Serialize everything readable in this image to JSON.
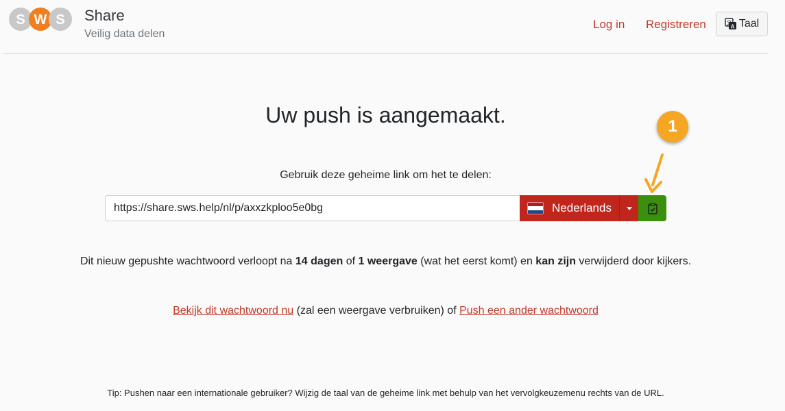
{
  "header": {
    "logo_text": "SWS",
    "title": "Share",
    "subtitle": "Veilig data delen",
    "login": "Log in",
    "register": "Registreren",
    "language_button": "Taal"
  },
  "main": {
    "heading": "Uw push is aangemaakt.",
    "instruction": "Gebruik deze geheime link om het te delen:",
    "secret_url": "https://share.sws.help/nl/p/axxzkploo5e0bg",
    "link_language": "Nederlands",
    "expiry": {
      "part1": "Dit nieuw gepushte wachtwoord verloopt na ",
      "days": "14 dagen",
      "part2": " of ",
      "views": "1 weergave",
      "part3": " (wat het eerst komt) en ",
      "deletable": "kan zijn",
      "part4": " verwijderd door kijkers."
    },
    "view_now_link": "Bekijk dit wachtwoord nu",
    "view_now_note": " (zal een weergave verbruiken) of ",
    "push_another_link": "Push een ander wachtwoord",
    "tip": "Tip: Pushen naar een internationale gebruiker? Wijzig de taal van de geheime link met behulp van het vervolgkeuzemenu rechts van de URL."
  },
  "annotation": {
    "badge_number": "1"
  },
  "colors": {
    "accent_red": "#c0261c",
    "link_red": "#c0392b",
    "copy_green": "#3a8f0c",
    "annotation_orange": "#f5a623"
  }
}
